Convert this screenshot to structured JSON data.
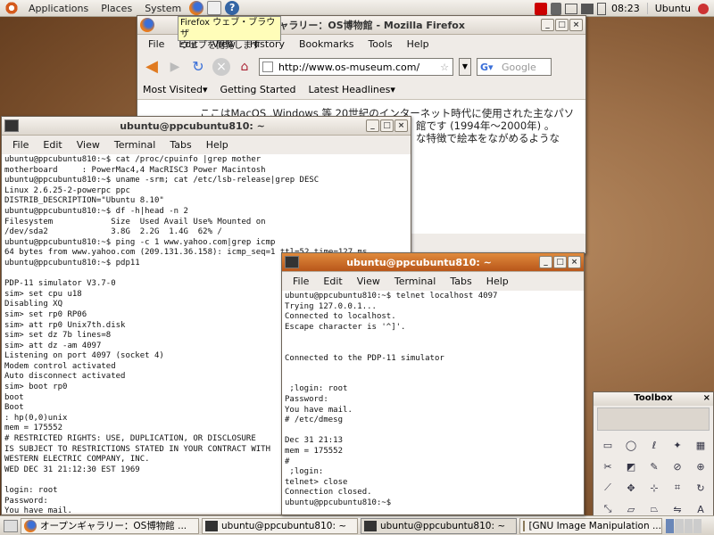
{
  "topbar": {
    "menus": [
      "Applications",
      "Places",
      "System"
    ],
    "clock": "08:23",
    "user": "Ubuntu"
  },
  "tooltip": {
    "line1": "Firefox ウェブ・ブラウザ",
    "line2": "ウェブを閲覧します"
  },
  "firefox": {
    "title": "オープンギャラリー：OS博物館 - Mozilla Firefox",
    "menus": [
      "File",
      "Edit",
      "View",
      "History",
      "Bookmarks",
      "Tools",
      "Help"
    ],
    "url": "http://www.os-museum.com/",
    "search_placeholder": "Google",
    "bookmarks": [
      "Most Visited▾",
      "Getting Started",
      "Latest Headlines▾"
    ],
    "content": [
      "ここはMacOS ,Windows 等 20世紀のインターネット時代に使用された主なパソ",
      "館です (1994年〜2000年) 。",
      "な特徴で絵本をながめるような"
    ]
  },
  "term1": {
    "title": "ubuntu@ppcubuntu810: ~",
    "menus": [
      "File",
      "Edit",
      "View",
      "Terminal",
      "Tabs",
      "Help"
    ],
    "text": "ubuntu@ppcubuntu810:~$ cat /proc/cpuinfo |grep mother\nmotherboard     : PowerMac4,4 MacRISC3 Power Macintosh\nubuntu@ppcubuntu810:~$ uname -srm; cat /etc/lsb-release|grep DESC\nLinux 2.6.25-2-powerpc ppc\nDISTRIB_DESCRIPTION=\"Ubuntu 8.10\"\nubuntu@ppcubuntu810:~$ df -h|head -n 2\nFilesystem            Size  Used Avail Use% Mounted on\n/dev/sda2             3.8G  2.2G  1.4G  62% /\nubuntu@ppcubuntu810:~$ ping -c 1 www.yahoo.com|grep icmp\n64 bytes from www.yahoo.com (209.131.36.158): icmp_seq=1 ttl=52 time=127 ms\nubuntu@ppcubuntu810:~$ pdp11\n\nPDP-11 simulator V3.7-0\nsim> set cpu u18\nDisabling XQ\nsim> set rp0 RP06\nsim> att rp0 Unix7th.disk\nsim> set dz 7b lines=8\nsim> att dz -am 4097\nListening on port 4097 (socket 4)\nModem control activated\nAuto disconnect activated\nsim> boot rp0\nboot\nBoot\n: hp(0,0)unix\nmem = 175552\n# RESTRICTED RIGHTS: USE, DUPLICATION, OR DISCLOSURE\nIS SUBJECT TO RESTRICTIONS STATED IN YOUR CONTRACT WITH\nWESTERN ELECTRIC COMPANY, INC.\nWED DEC 31 21:12:30 EST 1969\n\nlogin: root\nPassword:\nYou have mail.\n# █"
  },
  "term2": {
    "title": "ubuntu@ppcubuntu810: ~",
    "menus": [
      "File",
      "Edit",
      "View",
      "Terminal",
      "Tabs",
      "Help"
    ],
    "text": "ubuntu@ppcubuntu810:~$ telnet localhost 4097\nTrying 127.0.0.1...\nConnected to localhost.\nEscape character is '^]'.\n\n\nConnected to the PDP-11 simulator\n\n\n ;login: root\nPassword:\nYou have mail.\n# /etc/dmesg\n\nDec 31 21:13\nmem = 175552\n#\n ;login:\ntelnet> close\nConnection closed.\nubuntu@ppcubuntu810:~$"
  },
  "toolbox": {
    "title": "Toolbox"
  },
  "taskbar": {
    "items": [
      "オープンギャラリー：OS博物館 ...",
      "ubuntu@ppcubuntu810: ~",
      "ubuntu@ppcubuntu810: ~",
      "[GNU Image Manipulation ..."
    ]
  }
}
